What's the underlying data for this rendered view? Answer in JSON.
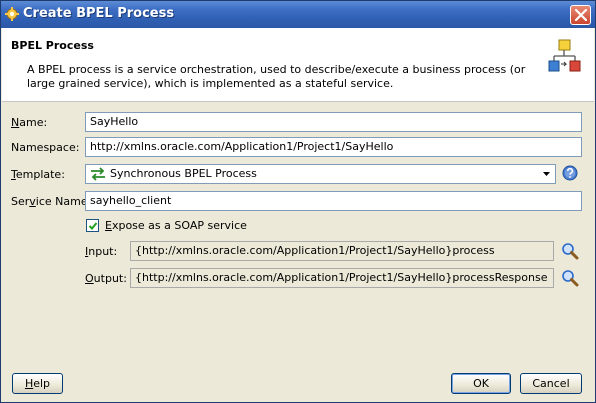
{
  "window": {
    "title": "Create BPEL Process",
    "icons": {
      "title": "bpel-gear-icon",
      "close": "close-icon"
    }
  },
  "header": {
    "title": "BPEL Process",
    "description": "A BPEL process is a service orchestration, used to describe/execute a business process (or large grained service), which is implemented as a stateful service.",
    "icon": "bpel-process-diagram-icon"
  },
  "form": {
    "name": {
      "mnemonic": "N",
      "label_rest": "ame:",
      "value": "SayHello"
    },
    "namespace": {
      "label": "Namespace:",
      "value": "http://xmlns.oracle.com/Application1/Project1/SayHello"
    },
    "template": {
      "mnemonic": "T",
      "label_rest": "emplate:",
      "value": "Synchronous BPEL Process",
      "icon": "synchronous-process-icon"
    },
    "service_name": {
      "label_pre": "Ser",
      "mnemonic": "v",
      "label_rest": "ice Name:",
      "value": "sayhello_client"
    },
    "expose_soap": {
      "mnemonic": "E",
      "label_rest": "xpose as a SOAP service",
      "checked": true
    },
    "input": {
      "mnemonic": "I",
      "label_rest": "nput:",
      "value": "{http://xmlns.oracle.com/Application1/Project1/SayHello}process"
    },
    "output": {
      "mnemonic": "O",
      "label_rest": "utput:",
      "value": "{http://xmlns.oracle.com/Application1/Project1/SayHello}processResponse"
    }
  },
  "buttons": {
    "help": {
      "mnemonic": "H",
      "label_rest": "elp"
    },
    "ok": "OK",
    "cancel": "Cancel"
  },
  "colors": {
    "titlebar": "#2f5fb3",
    "dialog_bg": "#ece9d8",
    "field_border": "#7f9db9",
    "close": "#c9462f"
  }
}
